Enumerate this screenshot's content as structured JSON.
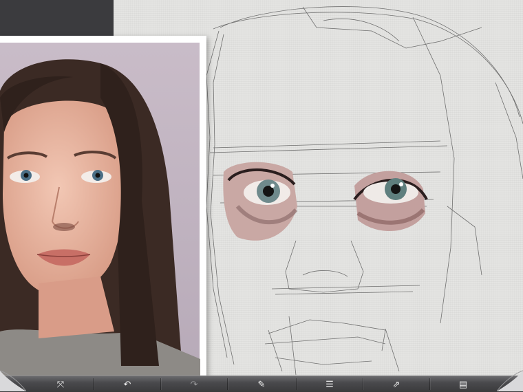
{
  "app": {
    "canvas_texture": "paper",
    "accent": "#3b3b3e"
  },
  "reference_photo": {
    "subject": "reference-portrait"
  },
  "toolbar": {
    "buttons": [
      {
        "name": "transform",
        "icon": "transform-arrows-icon",
        "glyph": "⤧"
      },
      {
        "name": "undo",
        "icon": "undo-icon",
        "glyph": "↶"
      },
      {
        "name": "redo",
        "icon": "redo-icon",
        "glyph": "↷"
      },
      {
        "name": "brush",
        "icon": "brush-tool-icon",
        "glyph": "✎"
      },
      {
        "name": "layers",
        "icon": "layers-icon",
        "glyph": "☰"
      },
      {
        "name": "export",
        "icon": "export-icon",
        "glyph": "⇗"
      },
      {
        "name": "gallery",
        "icon": "gallery-folder-icon",
        "glyph": "▤"
      }
    ]
  }
}
